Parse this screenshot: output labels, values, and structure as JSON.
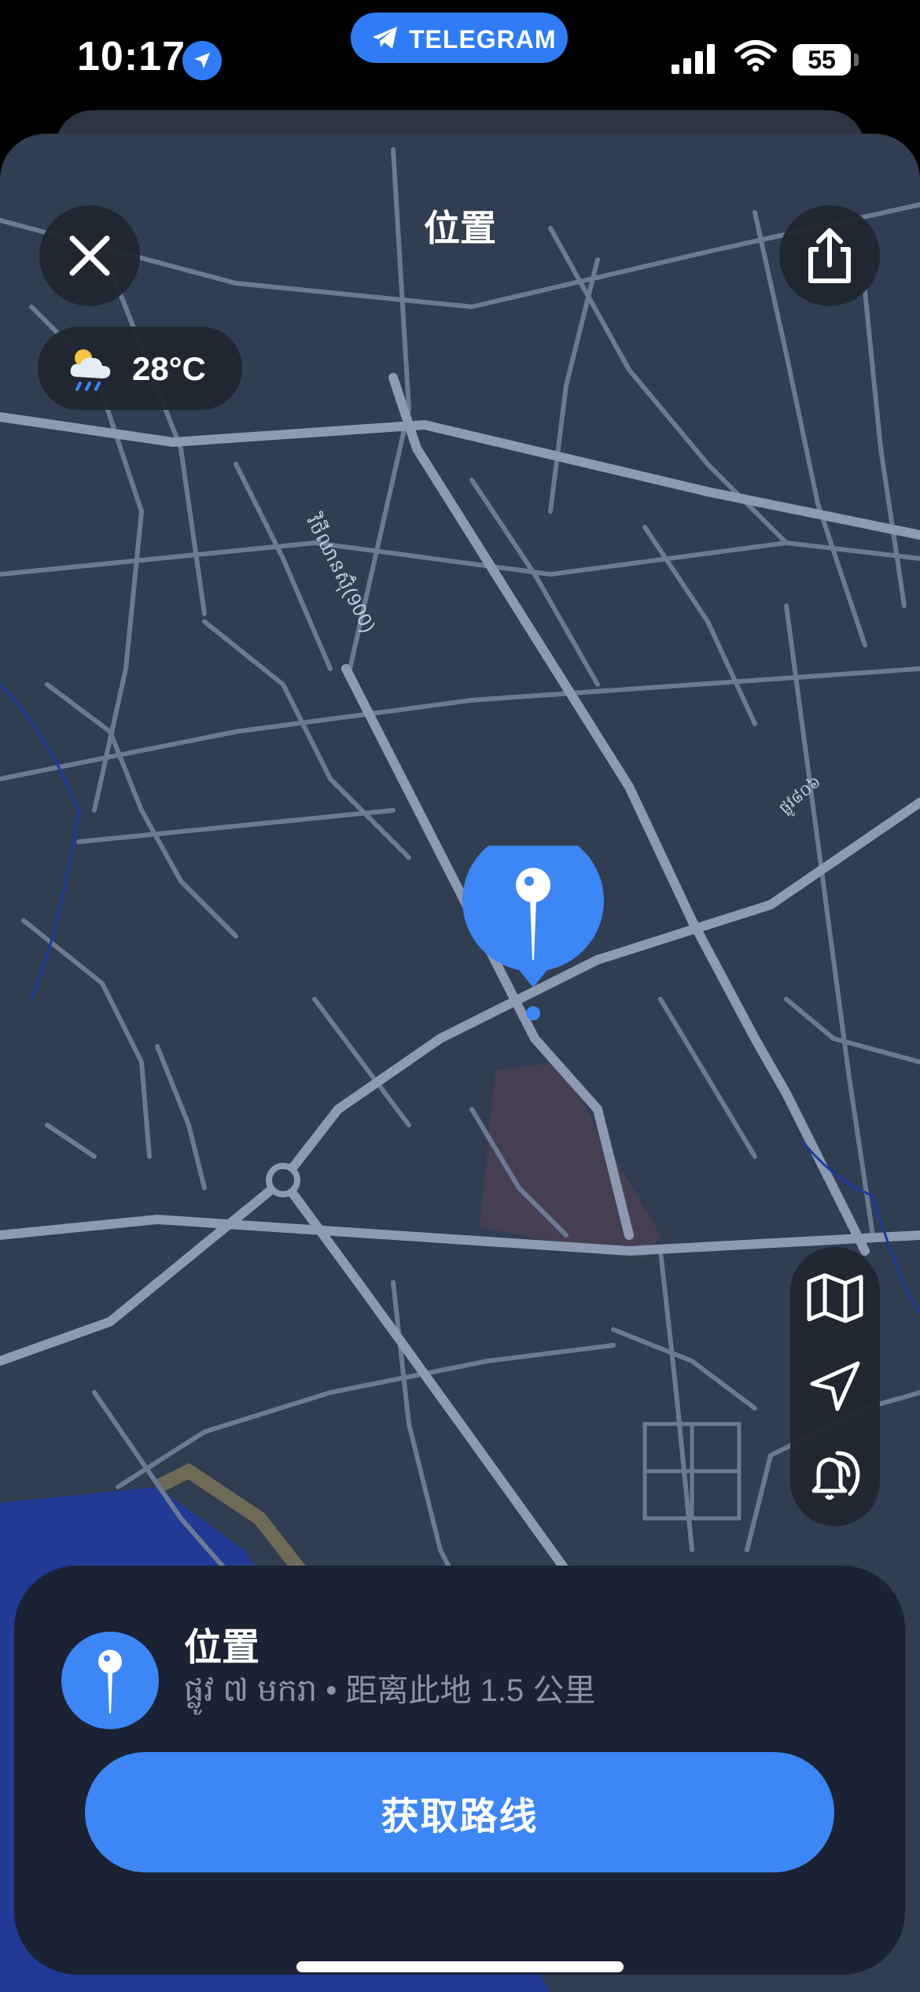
{
  "status_bar": {
    "time": "10:17",
    "notification_label": "TELEGRAM",
    "battery_level": "55",
    "icons": [
      "location-arrow-icon",
      "telegram-icon",
      "cellular-signal-icon",
      "wifi-icon",
      "battery-icon"
    ]
  },
  "header": {
    "title": "位置",
    "close_icon": "close-icon",
    "share_icon": "share-icon"
  },
  "weather": {
    "icon": "cloud-rain-sun-icon",
    "temperature": "28°C"
  },
  "map": {
    "street_label_1": "វិថីឈានស៊ុំ(900)",
    "street_label_2": "ផ្លូវ៨០៦",
    "controls": [
      "map-mode-icon",
      "my-location-icon",
      "weather-alert-icon"
    ]
  },
  "location_card": {
    "title": "位置",
    "subtitle": "ផ្លូវ ៧ មករា • 距离此地 1.5 公里",
    "route_button": "获取路线"
  },
  "colors": {
    "accent": "#3c86f6",
    "map_background": "#313d50",
    "road": "#6b7a92",
    "card_background": "#1b2234",
    "water": "#203a96"
  }
}
